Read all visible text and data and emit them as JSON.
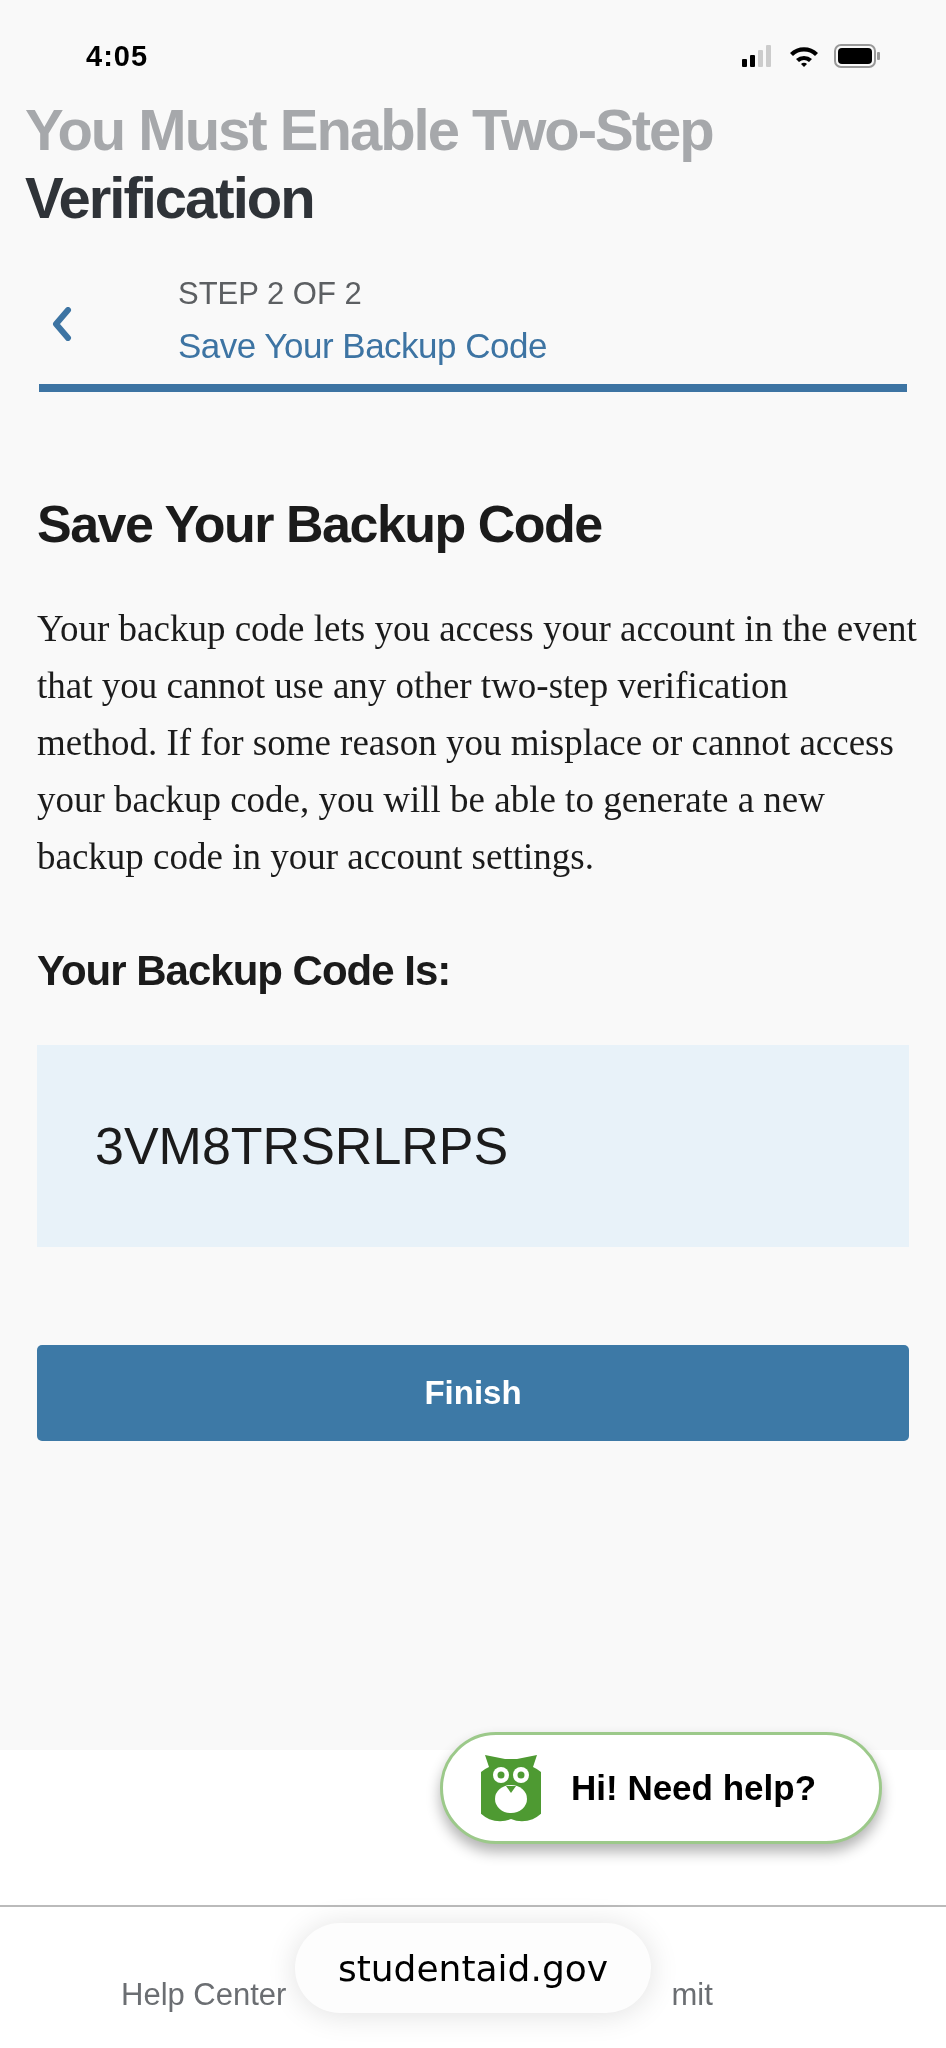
{
  "status_bar": {
    "time": "4:05"
  },
  "page_title": {
    "line_1": "You Must Enable Two-Step",
    "line_2": "Verification"
  },
  "stepper": {
    "step": "STEP 2 OF 2",
    "title": "Save Your Backup Code"
  },
  "heading": "Save Your Backup Code",
  "description": "Your backup code lets you access your account in the event that you cannot use any other two-step verification method. If for some reason you misplace or cannot access your backup code, you will be able to generate a new backup code in your account settings.",
  "code_label": "Your Backup Code Is:",
  "backup_code": "3VM8TRSRLRPS",
  "finish_button": "Finish",
  "help_chat": {
    "label": "Hi! Need help?"
  },
  "footer_links": [
    "Help Center",
    "mit"
  ],
  "url_bar": {
    "url": "studentaid.gov"
  }
}
